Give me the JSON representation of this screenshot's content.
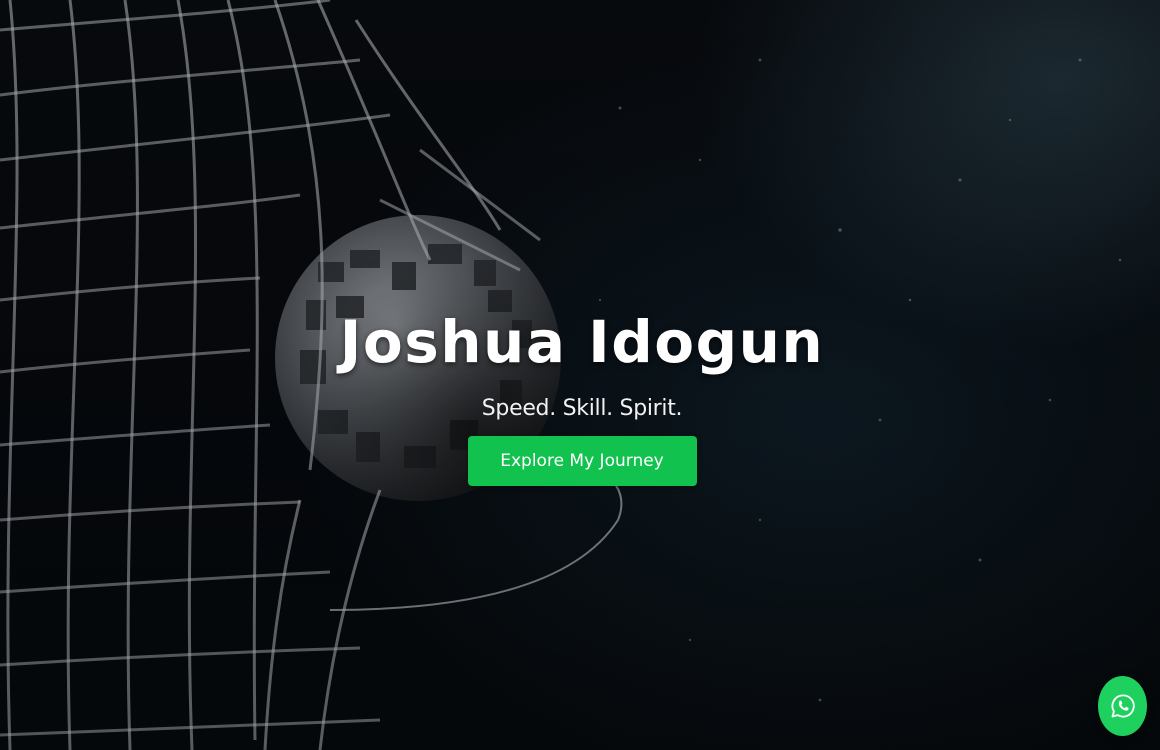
{
  "hero": {
    "title": "Joshua Idogun",
    "tagline": "Speed. Skill. Spirit.",
    "cta_label": "Explore My Journey",
    "background_image": "football-in-goal-net",
    "colors": {
      "accent": "#12c24f",
      "whatsapp": "#1ed15f",
      "background": "#05080b",
      "text": "#ffffff"
    }
  },
  "floating_action": {
    "icon": "whatsapp-icon"
  }
}
